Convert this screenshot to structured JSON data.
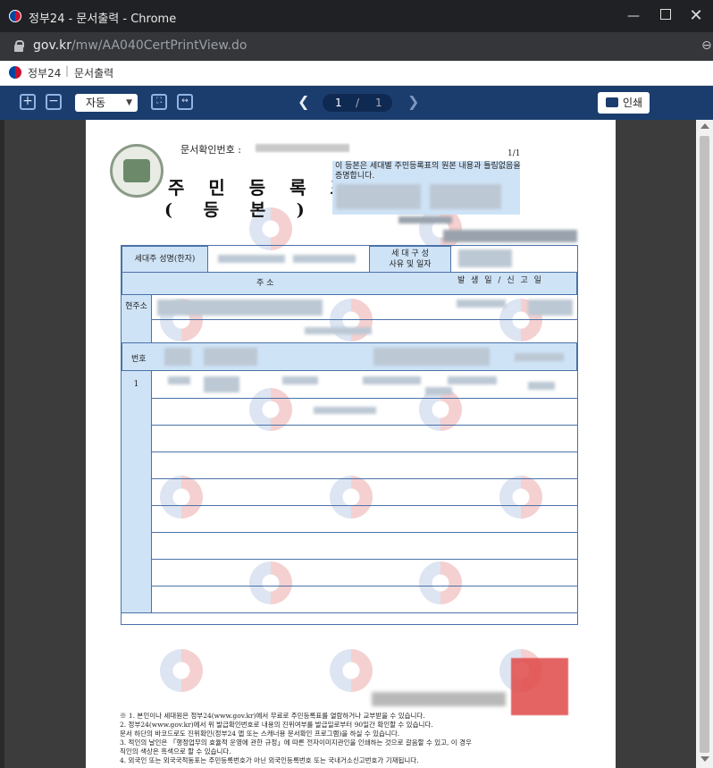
{
  "window": {
    "title": "정부24 - 문서출력 - Chrome",
    "minimize": "—",
    "close": "✕"
  },
  "address_bar": {
    "host": "gov.kr",
    "path": "/mw/AA040CertPrintView.do"
  },
  "site_header": {
    "site_name": "정부24",
    "separator": "|",
    "page_name": "문서출력"
  },
  "toolbar": {
    "zoom_in": "+",
    "zoom_out": "−",
    "zoom_value": "자동",
    "page_current": "1",
    "page_separator": "/",
    "page_total": "1",
    "print_label": "인쇄",
    "prev": "❮",
    "next": "❯"
  },
  "document": {
    "doc_number_label": "문서확인번호 :",
    "page_fraction": "1/1",
    "title": "주 민 등 록 표",
    "subtitle": "( 등  본 )",
    "cert_statement": "이 등본은 세대별 주민등록표의 원본 내용과 틀림없음을 증명합니다.",
    "table": {
      "householder_label": "세대주 성명(한자)",
      "household_reason_label_1": "세 대 구 성",
      "household_reason_label_2": "사유 및 일자",
      "address_header": "주          소",
      "date_header": "발 생 일 / 신 고 일",
      "current_address_label": "현주소",
      "number_label": "번호",
      "row_number": "1"
    },
    "notes_prefix": "※ 1.",
    "notes": [
      "※ 1. 본인이나 세대원은 정부24(www.gov.kr)에서 무료로 주민등록표를 열람하거나 교부받을 수 있습니다.",
      "   2. 정부24(www.gov.kr)에서 위 발급확인번호로 내용의 진위여부를 발급일로부터 90일간 확인할 수 있습니다.",
      "      문서 하단의 바코드로도 진위확인(정부24 앱 또는 스캐너용 문서확인 프로그램)을 하실 수 있습니다.",
      "   3. 적인의 날인은 「행정업무의 효율적 운영에 관한 규정」에 따른 전자이미지관인을 인쇄하는 것으로 갈음할 수 있고, 이 경우",
      "      직인의 색상은 흑색으로 할 수 있습니다.",
      "   4. 외국인 또는 외국국적동포는 주민등록번호가 아닌 외국인등록번호 또는 국내거소신고번호가 기재됩니다."
    ]
  }
}
